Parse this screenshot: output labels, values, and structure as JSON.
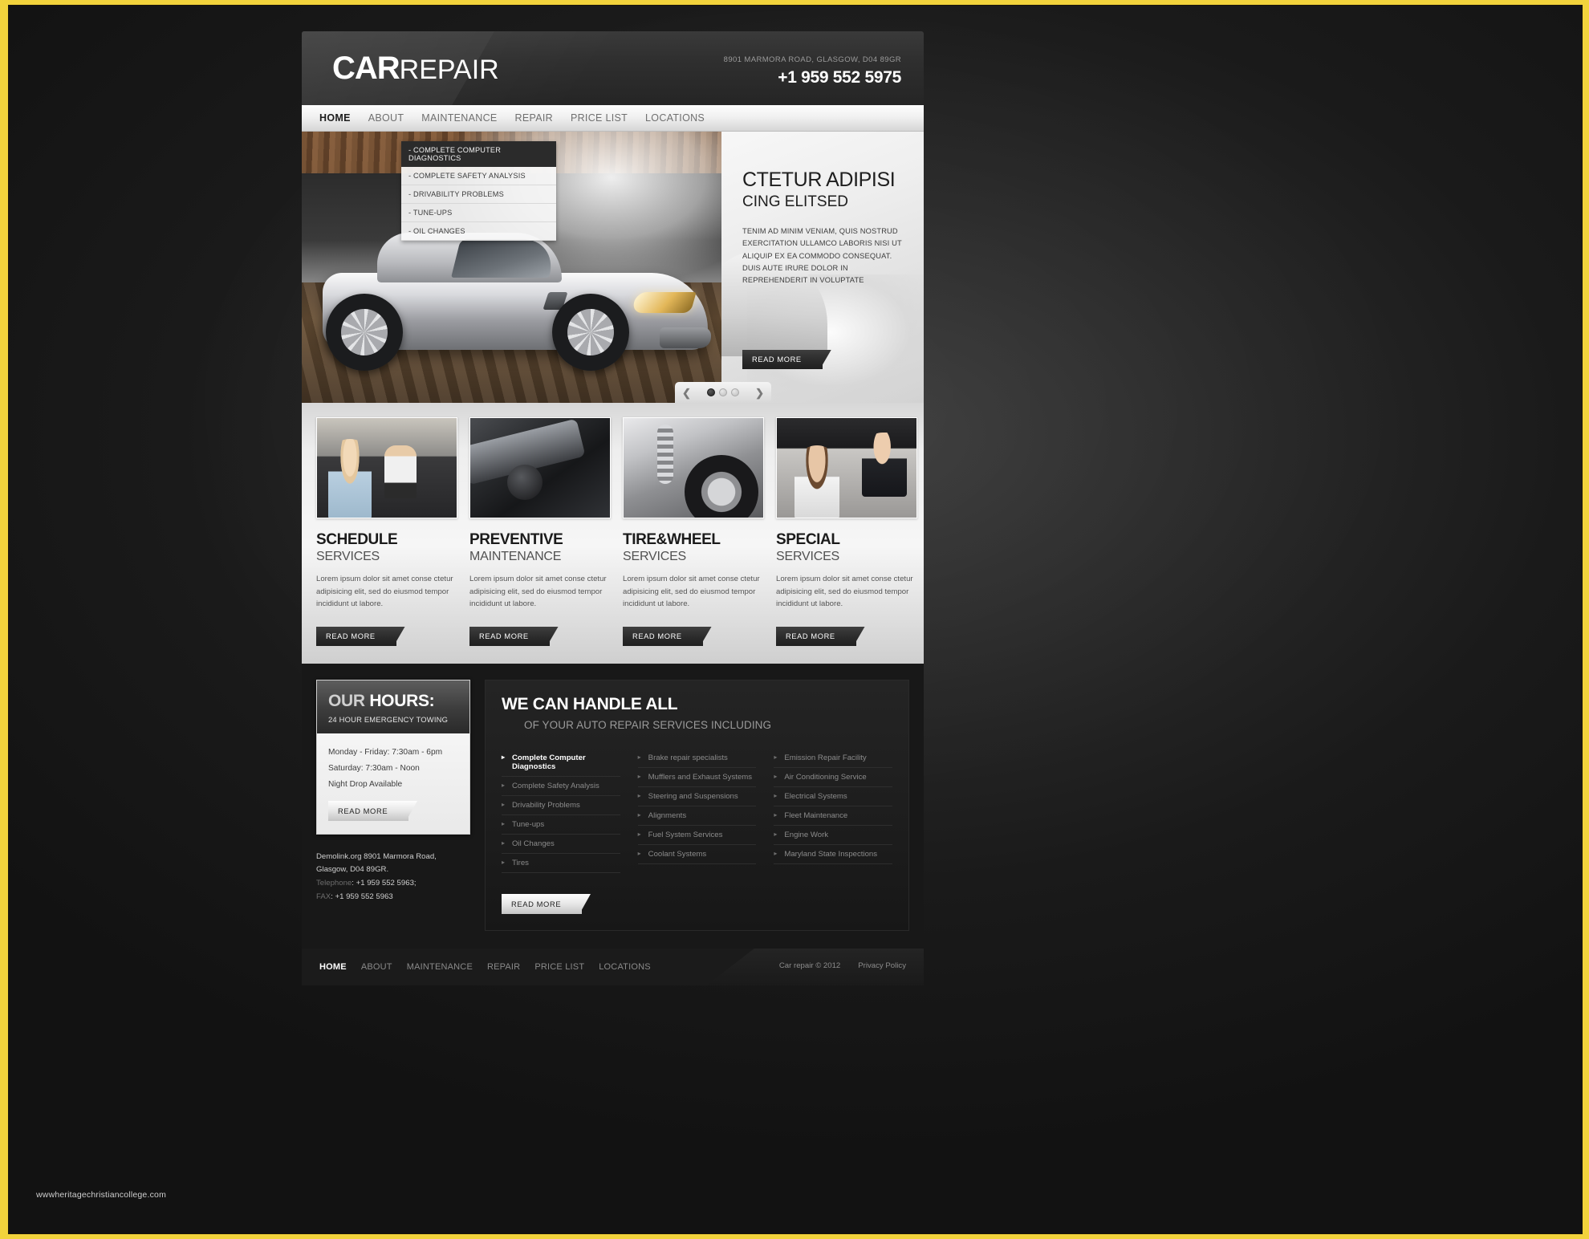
{
  "header": {
    "logo_bold": "CAR",
    "logo_light": "REPAIR",
    "address": "8901 MARMORA ROAD, GLASGOW,  D04 89GR",
    "phone": "+1 959 552 5975"
  },
  "nav": {
    "items": [
      {
        "label": "HOME",
        "active": true
      },
      {
        "label": "ABOUT",
        "active": false
      },
      {
        "label": "MAINTENANCE",
        "active": false
      },
      {
        "label": "REPAIR",
        "active": false
      },
      {
        "label": "PRICE LIST",
        "active": false
      },
      {
        "label": "LOCATIONS",
        "active": false
      }
    ]
  },
  "slider": {
    "feature_list": [
      "- COMPLETE COMPUTER DIAGNOSTICS",
      "- COMPLETE SAFETY ANALYSIS",
      "- DRIVABILITY PROBLEMS",
      "- TUNE-UPS",
      "- OIL CHANGES"
    ],
    "caption_title": "CTETUR ADIPISI",
    "caption_subtitle": "CING  ELITSED",
    "caption_text": "TENIM AD MINIM VENIAM, QUIS NOSTRUD EXERCITATION ULLAMCO LABORIS NISI UT ALIQUIP EX EA COMMODO CONSEQUAT. DUIS AUTE IRURE DOLOR IN REPREHENDERIT IN VOLUPTATE",
    "read_more": "READ MORE",
    "prev_icon": "❮",
    "next_icon": "❯",
    "dots": 3,
    "active_dot": 0
  },
  "services": [
    {
      "title_bold": "SCHEDULE",
      "title_light": "SERVICES",
      "text": "Lorem ipsum dolor sit amet conse ctetur adipisicing elit, sed do eiusmod tempor incididunt ut labore.",
      "button": "READ MORE",
      "image_name": "woman-mechanic-photo"
    },
    {
      "title_bold": "PREVENTIVE",
      "title_light": "MAINTENANCE",
      "text": "Lorem ipsum dolor sit amet conse ctetur adipisicing elit, sed do eiusmod tempor incididunt ut labore.",
      "button": "READ MORE",
      "image_name": "engine-bay-photo"
    },
    {
      "title_bold": "TIRE&WHEEL",
      "title_light": "SERVICES",
      "text": "Lorem ipsum dolor sit amet conse ctetur adipisicing elit, sed do eiusmod tempor incididunt ut labore.",
      "button": "READ MORE",
      "image_name": "suspension-wheel-photo"
    },
    {
      "title_bold": "SPECIAL",
      "title_light": "SERVICES",
      "text": "Lorem ipsum dolor sit amet conse ctetur adipisicing elit, sed do eiusmod tempor incididunt ut labore.",
      "button": "READ MORE",
      "image_name": "customer-keys-photo"
    }
  ],
  "hours": {
    "title_dim": "OUR ",
    "title_bright": "HOURS:",
    "subtitle": "24 HOUR EMERGENCY TOWING",
    "lines": [
      "Monday - Friday: 7:30am - 6pm",
      "Saturday: 7:30am - Noon",
      "Night Drop Available"
    ],
    "button": "READ MORE"
  },
  "contact": {
    "line1": "Demolink.org 8901 Marmora Road,",
    "line2": "Glasgow, D04 89GR.",
    "telephone_label": "Telephone",
    "telephone_value": ": +1 959 552 5963;",
    "fax_label": "FAX",
    "fax_value": ": +1 959 552 5963"
  },
  "handle": {
    "title": "WE CAN HANDLE ALL",
    "subtitle": "OF YOUR AUTO REPAIR SERVICES INCLUDING",
    "button": "READ MORE",
    "columns": [
      {
        "items": [
          {
            "label": "Complete Computer Diagnostics",
            "selected": true
          },
          {
            "label": "Complete Safety Analysis",
            "selected": false
          },
          {
            "label": "Drivability Problems",
            "selected": false
          },
          {
            "label": "Tune-ups",
            "selected": false
          },
          {
            "label": "Oil Changes",
            "selected": false
          },
          {
            "label": "Tires",
            "selected": false
          }
        ]
      },
      {
        "items": [
          {
            "label": "Brake repair specialists",
            "selected": false
          },
          {
            "label": "Mufflers and Exhaust Systems",
            "selected": false
          },
          {
            "label": "Steering and Suspensions",
            "selected": false
          },
          {
            "label": "Alignments",
            "selected": false
          },
          {
            "label": "Fuel System Services",
            "selected": false
          },
          {
            "label": "Coolant Systems",
            "selected": false
          }
        ]
      },
      {
        "items": [
          {
            "label": "Emission Repair Facility",
            "selected": false
          },
          {
            "label": "Air Conditioning Service",
            "selected": false
          },
          {
            "label": "Electrical Systems",
            "selected": false
          },
          {
            "label": "Fleet Maintenance",
            "selected": false
          },
          {
            "label": "Engine Work",
            "selected": false
          },
          {
            "label": "Maryland State Inspections",
            "selected": false
          }
        ]
      }
    ]
  },
  "footer": {
    "nav": [
      {
        "label": "HOME",
        "active": true
      },
      {
        "label": "ABOUT",
        "active": false
      },
      {
        "label": "MAINTENANCE",
        "active": false
      },
      {
        "label": "REPAIR",
        "active": false
      },
      {
        "label": "PRICE LIST",
        "active": false
      },
      {
        "label": "LOCATIONS",
        "active": false
      }
    ],
    "copyright": "Car repair © 2012",
    "privacy": "Privacy Policy"
  },
  "watermark": "wwwheritagechristiancollege.com",
  "colors": {
    "page_border": "#f2d33c",
    "background_dark": "#1a1a1a",
    "accent_dark": "#2b2b2b",
    "nav_light": "#f1f1f1"
  }
}
